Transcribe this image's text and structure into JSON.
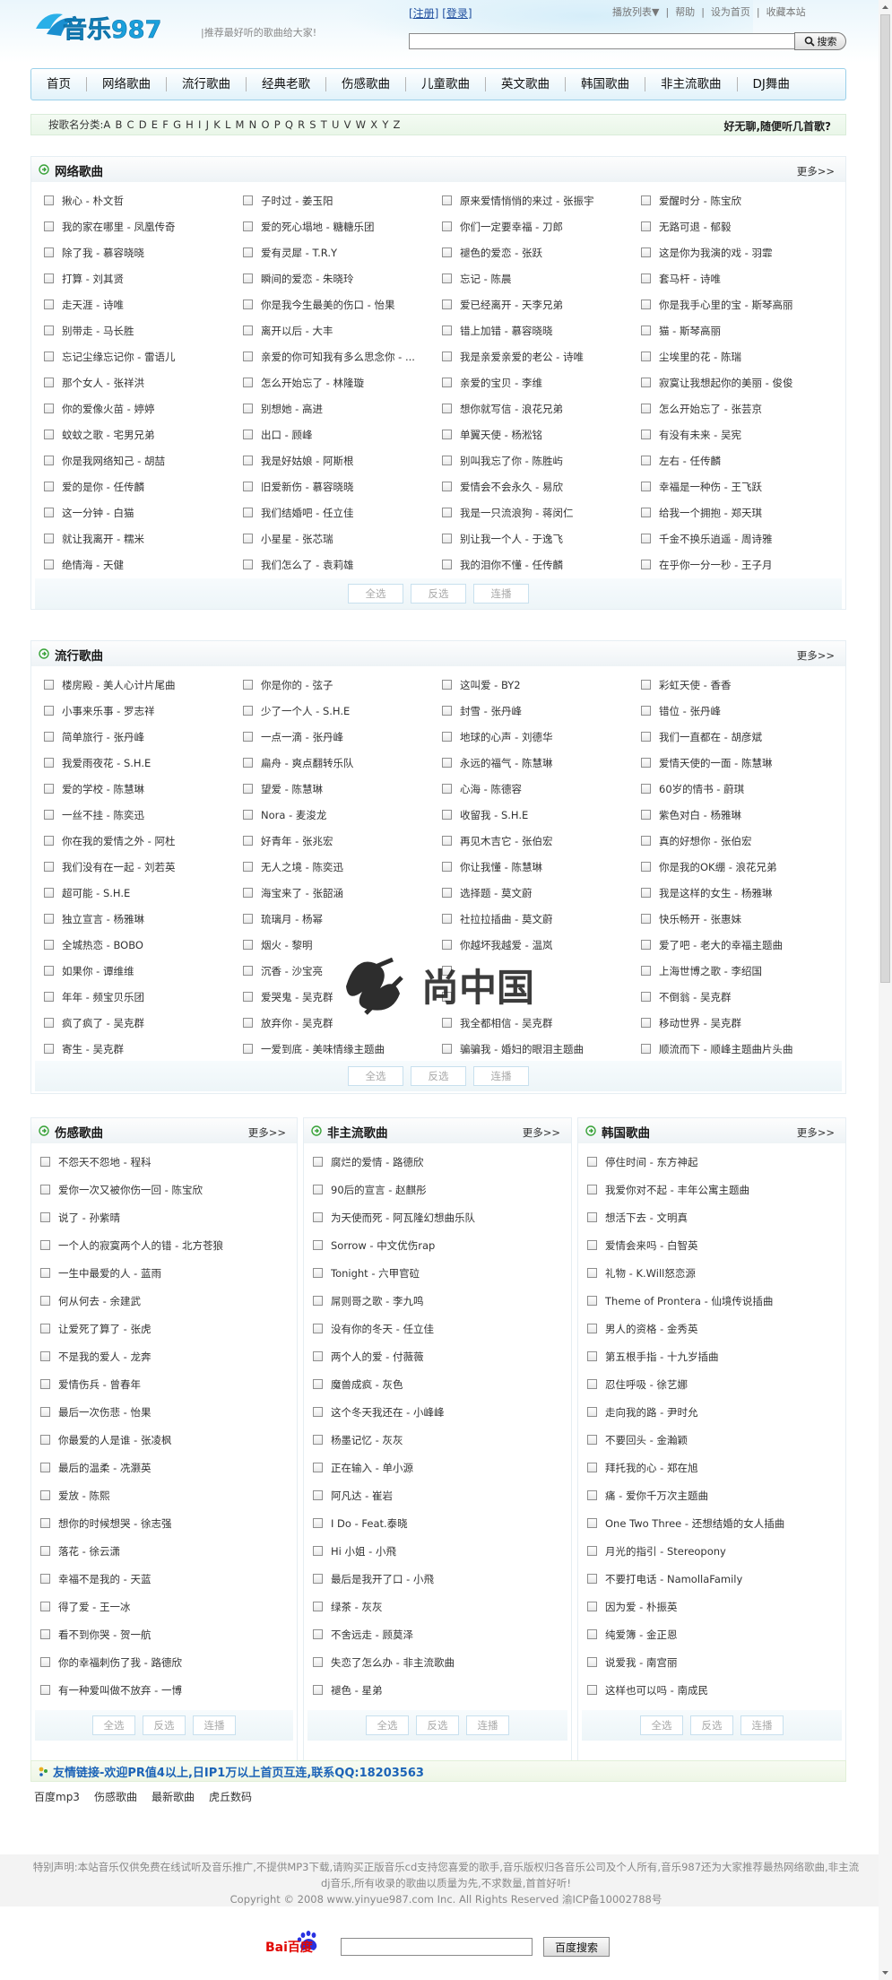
{
  "header": {
    "logo_text": "音乐987",
    "tagline": "|推荐最好听的歌曲给大家!",
    "register": "[注册]",
    "login": "[登录]",
    "top_links": [
      "播放列表▼",
      "帮助",
      "设为首页",
      "收藏本站"
    ],
    "search_button": "搜索"
  },
  "nav": {
    "items": [
      "首页",
      "网络歌曲",
      "流行歌曲",
      "经典老歌",
      "伤感歌曲",
      "儿童歌曲",
      "英文歌曲",
      "韩国歌曲",
      "非主流歌曲",
      "DJ舞曲"
    ]
  },
  "alpha": {
    "label": "按歌名分类:",
    "letters": [
      "A",
      "B",
      "C",
      "D",
      "E",
      "F",
      "G",
      "H",
      "I",
      "J",
      "K",
      "L",
      "M",
      "N",
      "O",
      "P",
      "Q",
      "R",
      "S",
      "T",
      "U",
      "V",
      "W",
      "X",
      "Y",
      "Z"
    ],
    "right_text": "好无聊,随便听几首歌?"
  },
  "sections": {
    "wangluo": {
      "title": "网络歌曲",
      "more": "更多>>",
      "songs": [
        [
          "揪心 - 朴文哲",
          "子时过 - 姜玉阳",
          "原来爱情悄悄的来过 - 张振宇",
          "爱醒时分 - 陈宝欣"
        ],
        [
          "我的家在哪里 - 凤凰传奇",
          "爱的死心塌地 - 糖糖乐团",
          "你们一定要幸福 - 刀郎",
          "无路可退 - 郁毅"
        ],
        [
          "除了我 - 慕容晓晓",
          "爱有灵犀 - T.R.Y",
          "褪色的爱恋 - 张跃",
          "这是你为我演的戏 - 羽霏"
        ],
        [
          "打算 - 刘其贤",
          "瞬间的爱恋 - 朱晓玲",
          "忘记 - 陈晨",
          "套马杆 - 诗唯"
        ],
        [
          "走天涯 - 诗唯",
          "你是我今生最美的伤口 - 怡果",
          "爱已经离开 - 天李兄弟",
          "你是我手心里的宝 - 斯琴高丽"
        ],
        [
          "别带走 - 马长胜",
          "离开以后 - 大丰",
          "错上加错 - 慕容晓晓",
          "猫 - 斯琴高丽"
        ],
        [
          "忘记尘缘忘记你 - 雷语儿",
          "亲爱的你可知我有多么思念你 - ...",
          "我是亲爱亲爱的老公 - 诗唯",
          "尘埃里的花 - 陈瑞"
        ],
        [
          "那个女人 - 张祥洪",
          "怎么开始忘了 - 林隆璇",
          "亲爱的宝贝 - 李维",
          "寂寞让我想起你的美丽 - 俊俊"
        ],
        [
          "你的爱像火苗 - 婷婷",
          "别想她 - 高进",
          "想你就写信 - 浪花兄弟",
          "怎么开始忘了 - 张芸京"
        ],
        [
          "蚊蚊之歌 - 宅男兄弟",
          "出口 - 顾峰",
          "单翼天使 - 杨淞铭",
          "有没有未来 - 吴宪"
        ],
        [
          "你是我网络知己 - 胡喆",
          "我是好姑娘 - 阿斯根",
          "别叫我忘了你 - 陈胜屿",
          "左右 - 任传麟"
        ],
        [
          "爱的是你 - 任传麟",
          "旧爱新伤 - 慕容晓晓",
          "爱情会不会永久 - 易欣",
          "幸福是一种伤 - 王飞跃"
        ],
        [
          "这一分钟 - 白猫",
          "我们结婚吧 - 任立佳",
          "我是一只流浪狗 - 蒋闵仁",
          "给我一个拥抱 - 郑天琪"
        ],
        [
          "就让我离开 - 糯米",
          "小星星 - 张芯瑞",
          "别让我一个人 - 于逸飞",
          "千金不换乐逍遥 - 周诗雅"
        ],
        [
          "绝情海 - 天健",
          "我们怎么了 - 袁莉雄",
          "我的泪你不懂 - 任传麟",
          "在乎你一分一秒 - 王子月"
        ]
      ]
    },
    "liuxing": {
      "title": "流行歌曲",
      "more": "更多>>",
      "songs": [
        [
          "楼房殿 - 美人心计片尾曲",
          "你是你的 - 弦子",
          "这叫爱 - BY2",
          "彩虹天使 - 香香"
        ],
        [
          "小事来乐事 - 罗志祥",
          "少了一个人 - S.H.E",
          "封雪 - 张丹峰",
          "错位 - 张丹峰"
        ],
        [
          "简单旅行 - 张丹峰",
          "一点一滴 - 张丹峰",
          "地球的心声 - 刘德华",
          "我们一直都在 - 胡彦斌"
        ],
        [
          "我爱雨夜花 - S.H.E",
          "扁舟 - 爽点翻转乐队",
          "永远的福气 - 陈慧琳",
          "爱情天使的一面 - 陈慧琳"
        ],
        [
          "爱的学校 - 陈慧琳",
          "望爱 - 陈慧琳",
          "心海 - 陈德容",
          "60岁的情书 - 蔚琪"
        ],
        [
          "一丝不挂 - 陈奕迅",
          "Nora - 麦浚龙",
          "收留我 - S.H.E",
          "紫色对白 - 杨雅琳"
        ],
        [
          "你在我的爱情之外 - 阿杜",
          "好青年 - 张兆宏",
          "再见木吉它 - 张伯宏",
          "真的好想你 - 张伯宏"
        ],
        [
          "我们没有在一起 - 刘若英",
          "无人之境 - 陈奕迅",
          "你让我懂 - 陈慧琳",
          "你是我的OK绷 - 浪花兄弟"
        ],
        [
          "超可能 - S.H.E",
          "海宝来了 - 张韶涵",
          "选择题 - 莫文蔚",
          "我是这样的女生 - 杨雅琳"
        ],
        [
          "独立宣言 - 杨雅琳",
          "琉璃月 - 杨幂",
          "社拉拉插曲 - 莫文蔚",
          "快乐畅开 - 张惠妹"
        ],
        [
          "全城热恋 - BOBO",
          "烟火 - 黎明",
          "你越坏我越爱 - 温岚",
          "爱了吧 - 老大的幸福主题曲"
        ],
        [
          "如果你 - 谭维维",
          "沉香 - 沙宝亮",
          "",
          "上海世博之歌 - 李绍国"
        ],
        [
          "年年 - 频宝贝乐团",
          "爱哭鬼 - 吴克群",
          "",
          "不倒翁 - 吴克群"
        ],
        [
          "疯了疯了 - 吴克群",
          "放弃你 - 吴克群",
          "我全都相信 - 吴克群",
          "移动世界 - 吴克群"
        ],
        [
          "寄生 - 吴克群",
          "一爱到底 - 美味情缘主题曲",
          "骗骗我 - 婚妇的眼泪主题曲",
          "顺流而下 - 顺峰主题曲片头曲"
        ]
      ]
    },
    "shanggan": {
      "title": "伤感歌曲",
      "more": "更多>>",
      "songs": [
        "不怨天不怨地 - 程科",
        "爱你一次又被你伤一回 - 陈宝欣",
        "说了 - 孙紫晴",
        "一个人的寂寞两个人的错 - 北方苍狼",
        "一生中最爱的人 - 蓝雨",
        "何从何去 - 余建武",
        "让爱死了算了 - 张虎",
        "不是我的爱人 - 龙奔",
        "爱情伤兵 - 曾春年",
        "最后一次伤悲 - 怡果",
        "你最爱的人是谁 - 张凌枫",
        "最后的温柔 - 冼灏英",
        "爱放 - 陈熙",
        "想你的时候想哭 - 徐志强",
        "落花 - 徐云潇",
        "幸福不是我的 - 天蓝",
        "得了爱 - 王一冰",
        "看不到你哭 - 贺一航",
        "你的幸福刺伤了我 - 路德欣",
        "有一种爱叫做不放弃 - 一博"
      ]
    },
    "feizhuliu": {
      "title": "非主流歌曲",
      "more": "更多>>",
      "songs": [
        "腐烂的爱情 - 路德欣",
        "90后的宣言 - 赵麒彤",
        "为天使而死 - 阿瓦隆幻想曲乐队",
        "Sorrow - 中文优伤rap",
        "Tonight - 六甲官砬",
        "屌则哥之歌 - 李九鸣",
        "没有你的冬天 - 任立佳",
        "两个人的爱 - 付薇薇",
        "魔兽成疯 - 灰色",
        "这个冬天我还在 - 小峰峰",
        "杨墨记忆 - 灰灰",
        "正在输入 - 单小源",
        "阿凡达 - 崔岩",
        "I Do - Feat.泰晓",
        "Hi 小姐 - 小飛",
        "最后是我开了口 - 小飛",
        "绿茶 - 灰灰",
        "不舍远走 - 顾莫泽",
        "失恋了怎么办 - 非主流歌曲",
        "褪色 - 星弟"
      ]
    },
    "hanguo": {
      "title": "韩国歌曲",
      "more": "更多>>",
      "songs": [
        "停住时间 - 东方神起",
        "我爱你对不起 - 丰年公寓主题曲",
        "想活下去 - 文明真",
        "爱情会来吗 - 白智英",
        "礼物 - K.Will怒恋源",
        "Theme of Prontera - 仙境传说插曲",
        "男人的资格 - 金秀英",
        "第五根手指 - 十九岁插曲",
        "忍住呼吸 - 徐艺娜",
        "走向我的路 - 尹时允",
        "不要回头 - 金瀚颖",
        "拜托我的心 - 郑在旭",
        "痛 - 爱你千万次主题曲",
        "One Two Three - 还想结婚的女人插曲",
        "月光的指引 - Stereopony",
        "不要打电话 - NamollaFamily",
        "因为爱 - 朴振英",
        "纯爱簿 - 金正恩",
        "说爱我 - 南宫丽",
        "这样也可以吗 - 南成民"
      ]
    }
  },
  "buttons": {
    "select_all": "全选",
    "invert": "反选",
    "play": "连播"
  },
  "friend_links": {
    "title": "友情链接-欢迎PR值4以上,日IP1万以上首页互连,联系QQ:18203563",
    "items": [
      "百度mp3",
      "伤感歌曲",
      "最新歌曲",
      "虎丘数码"
    ]
  },
  "footer": {
    "disclaimer": [
      "特别声明:本站音乐仅供免费在线试听及音乐推广,不提供MP3下载,请购买正版音乐cd支持您喜爱的歌手,音乐版权归各音乐公司及个人所有,音乐987还为大家推荐最热网络歌曲,非主流",
      "dj音乐,所有收录的歌曲以质量为先,不求数量,首首好听!"
    ],
    "copyright": "Copyright © 2008 www.yinyue987.com Inc. All Rights Reserved 渝ICP备10002788号",
    "baidu_logo": "Bai百度",
    "baidu_button": "百度搜索"
  },
  "watermark_text": "尚中国",
  "colors": {
    "link_blue": "#1f4e9e",
    "friend_blue": "#1c63b7",
    "accent_green": "#3aa33a",
    "logo_blue": "#1aa0dc"
  }
}
